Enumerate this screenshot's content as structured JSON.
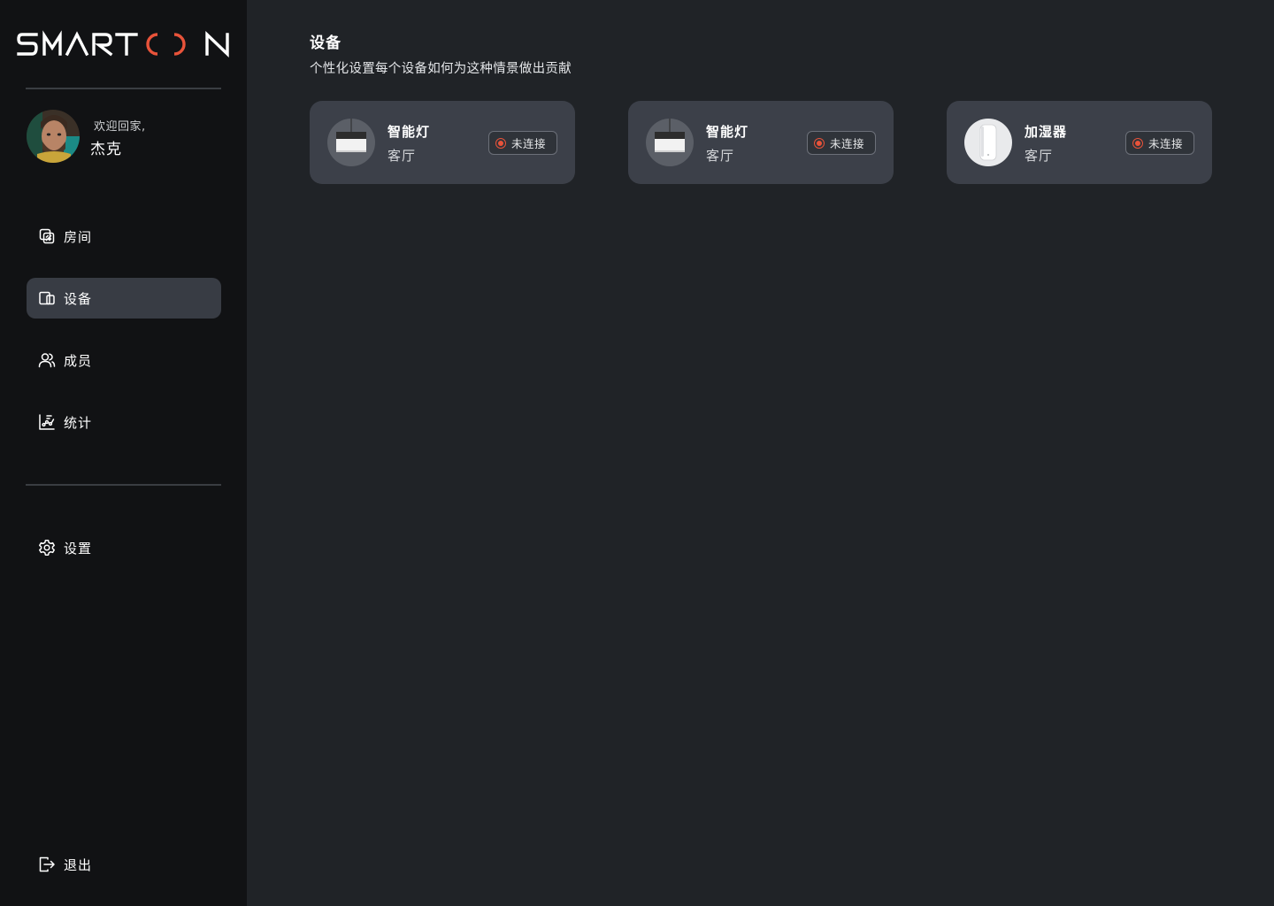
{
  "brand": {
    "name": "SMARTON",
    "accent_color": "#e8533a"
  },
  "user": {
    "welcome": "欢迎回家,",
    "name": "杰克",
    "avatar": "avatar-photo"
  },
  "nav": {
    "items": [
      {
        "label": "房间",
        "icon": "rooms-icon",
        "active": false
      },
      {
        "label": "设备",
        "icon": "devices-icon",
        "active": true
      },
      {
        "label": "成员",
        "icon": "members-icon",
        "active": false
      },
      {
        "label": "统计",
        "icon": "stats-icon",
        "active": false
      }
    ],
    "settings": {
      "label": "设置",
      "icon": "gear-icon"
    },
    "logout": {
      "label": "退出",
      "icon": "logout-icon"
    }
  },
  "main": {
    "title": "设备",
    "subtitle": "个性化设置每个设备如何为这种情景做出贡献",
    "devices": [
      {
        "name": "智能灯",
        "room": "客厅",
        "status": "未连接",
        "image": "pendant-lamp"
      },
      {
        "name": "智能灯",
        "room": "客厅",
        "status": "未连接",
        "image": "pendant-lamp"
      },
      {
        "name": "加湿器",
        "room": "客厅",
        "status": "未连接",
        "image": "humidifier"
      }
    ]
  }
}
